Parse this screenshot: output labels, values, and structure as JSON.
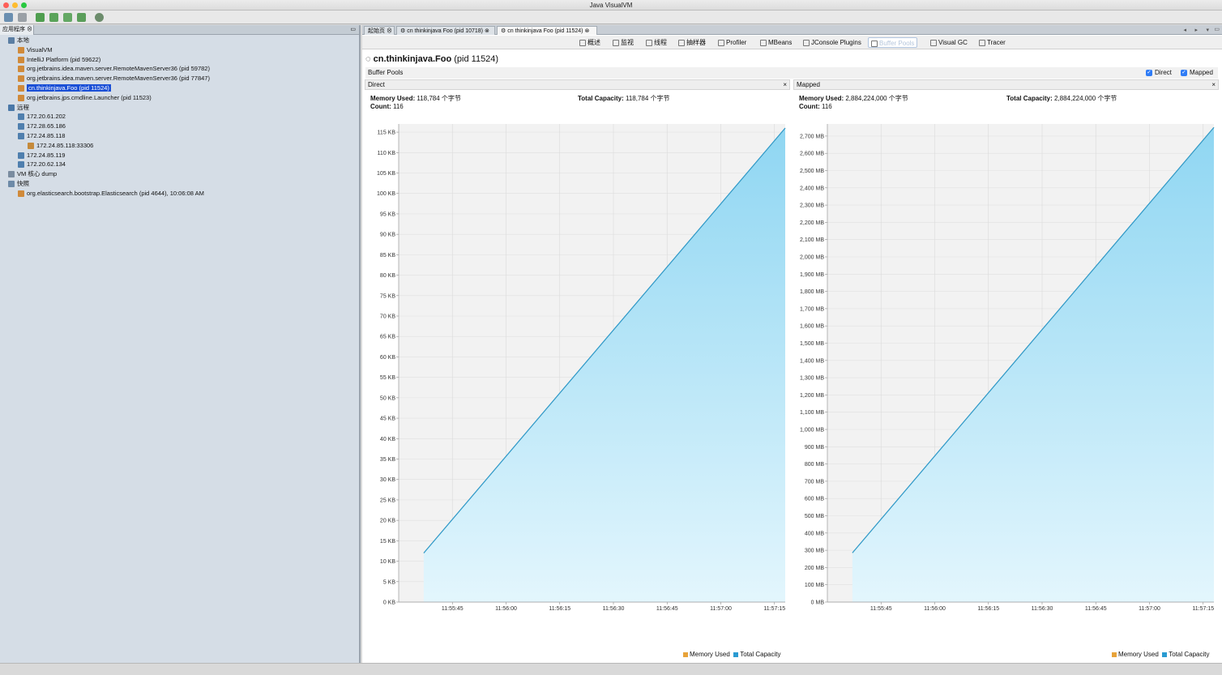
{
  "window": {
    "title": "Java VisualVM"
  },
  "left_panel": {
    "tab_label": "应用程序",
    "tree": [
      {
        "label": "本地",
        "level": 0,
        "icon": "computer-icon"
      },
      {
        "label": "VisualVM",
        "level": 1,
        "icon": "app-icon"
      },
      {
        "label": "IntelliJ Platform (pid 59622)",
        "level": 1,
        "icon": "app-icon"
      },
      {
        "label": "org.jetbrains.idea.maven.server.RemoteMavenServer36 (pid 59782)",
        "level": 1,
        "icon": "app-icon"
      },
      {
        "label": "org.jetbrains.idea.maven.server.RemoteMavenServer36 (pid 77847)",
        "level": 1,
        "icon": "app-icon"
      },
      {
        "label": "cn.thinkinjava.Foo (pid 11524)",
        "level": 1,
        "icon": "app-icon",
        "selected": true
      },
      {
        "label": "org.jetbrains.jps.cmdline.Launcher (pid 11523)",
        "level": 1,
        "icon": "app-icon"
      },
      {
        "label": "远程",
        "level": 0,
        "icon": "network-icon"
      },
      {
        "label": "172.20.61.202",
        "level": 1,
        "icon": "host-icon"
      },
      {
        "label": "172.28.65.186",
        "level": 1,
        "icon": "host-icon"
      },
      {
        "label": "172.24.85.118",
        "level": 1,
        "icon": "host-icon"
      },
      {
        "label": "172.24.85.118:33306",
        "level": 2,
        "icon": "jmx-icon"
      },
      {
        "label": "172.24.85.119",
        "level": 1,
        "icon": "host-icon"
      },
      {
        "label": "172.20.62.134",
        "level": 1,
        "icon": "host-icon"
      },
      {
        "label": "VM 核心 dump",
        "level": 0,
        "icon": "coredump-icon"
      },
      {
        "label": "快照",
        "level": 0,
        "icon": "snapshot-icon"
      },
      {
        "label": "org.elasticsearch.bootstrap.Elasticsearch (pid 4644), 10:06:08 AM",
        "level": 1,
        "icon": "app-icon"
      }
    ]
  },
  "doc_tabs": [
    {
      "label": "起始页"
    },
    {
      "label": "cn thinkinjava Foo (pid 10718)"
    },
    {
      "label": "cn thinkinjava Foo (pid 11524)",
      "active": true
    }
  ],
  "sub_tabs": [
    {
      "label": "概述"
    },
    {
      "label": "监视"
    },
    {
      "label": "线程"
    },
    {
      "label": "抽样器"
    },
    {
      "label": "Profiler"
    },
    {
      "label": "MBeans"
    },
    {
      "label": "JConsole Plugins"
    },
    {
      "label": "Buffer Pools",
      "active": true
    },
    {
      "label": "Visual GC"
    },
    {
      "label": "Tracer"
    }
  ],
  "main": {
    "app_name": "cn.thinkinjava.Foo",
    "app_pid": "(pid 11524)",
    "section_title": "Buffer Pools",
    "checkbox_direct": "Direct",
    "checkbox_mapped": "Mapped"
  },
  "panels": [
    {
      "title": "Direct",
      "memory_used_label": "Memory Used:",
      "memory_used_value": "118,784 个字节",
      "total_capacity_label": "Total Capacity:",
      "total_capacity_value": "118,784 个字节",
      "count_label": "Count:",
      "count_value": "116"
    },
    {
      "title": "Mapped",
      "memory_used_label": "Memory Used:",
      "memory_used_value": "2,884,224,000 个字节",
      "total_capacity_label": "Total Capacity:",
      "total_capacity_value": "2,884,224,000 个字节",
      "count_label": "Count:",
      "count_value": "116"
    }
  ],
  "legend": {
    "memory_used": "Memory Used",
    "total_capacity": "Total Capacity"
  },
  "colors": {
    "memory_used": "#e8a33a",
    "total_capacity": "#2a9bd1",
    "fill": "#b6e4f6",
    "selection": "#1a4fd6"
  },
  "chart_data": [
    {
      "type": "area",
      "title": "Direct",
      "x": [
        "11:55:45",
        "11:56:00",
        "11:56:15",
        "11:56:30",
        "11:56:45",
        "11:57:00",
        "11:57:15"
      ],
      "x_start": "11:55:30",
      "x_end": "11:57:18",
      "series": [
        {
          "name": "Memory Used",
          "points": [
            [
              "11:55:37",
              12
            ],
            [
              "11:57:18",
              116
            ]
          ]
        },
        {
          "name": "Total Capacity",
          "points": [
            [
              "11:55:37",
              12
            ],
            [
              "11:57:18",
              116
            ]
          ]
        }
      ],
      "ylabel": "KB",
      "ylim": [
        0,
        117
      ],
      "yticks": [
        "0 KB",
        "5 KB",
        "10 KB",
        "15 KB",
        "20 KB",
        "25 KB",
        "30 KB",
        "35 KB",
        "40 KB",
        "45 KB",
        "50 KB",
        "55 KB",
        "60 KB",
        "65 KB",
        "70 KB",
        "75 KB",
        "80 KB",
        "85 KB",
        "90 KB",
        "95 KB",
        "100 KB",
        "105 KB",
        "110 KB",
        "115 KB"
      ],
      "ytick_step": 5,
      "grid": true
    },
    {
      "type": "area",
      "title": "Mapped",
      "x": [
        "11:55:45",
        "11:56:00",
        "11:56:15",
        "11:56:30",
        "11:56:45",
        "11:57:00",
        "11:57:15"
      ],
      "x_start": "11:55:30",
      "x_end": "11:57:18",
      "series": [
        {
          "name": "Memory Used",
          "points": [
            [
              "11:55:37",
              285
            ],
            [
              "11:57:18",
              2750
            ]
          ]
        },
        {
          "name": "Total Capacity",
          "points": [
            [
              "11:55:37",
              285
            ],
            [
              "11:57:18",
              2750
            ]
          ]
        }
      ],
      "ylabel": "MB",
      "ylim": [
        0,
        2770
      ],
      "yticks": [
        "0 MB",
        "100 MB",
        "200 MB",
        "300 MB",
        "400 MB",
        "500 MB",
        "600 MB",
        "700 MB",
        "800 MB",
        "900 MB",
        "1,000 MB",
        "1,100 MB",
        "1,200 MB",
        "1,300 MB",
        "1,400 MB",
        "1,500 MB",
        "1,600 MB",
        "1,700 MB",
        "1,800 MB",
        "1,900 MB",
        "2,000 MB",
        "2,100 MB",
        "2,200 MB",
        "2,300 MB",
        "2,400 MB",
        "2,500 MB",
        "2,600 MB",
        "2,700 MB"
      ],
      "ytick_step": 100,
      "grid": true
    }
  ]
}
